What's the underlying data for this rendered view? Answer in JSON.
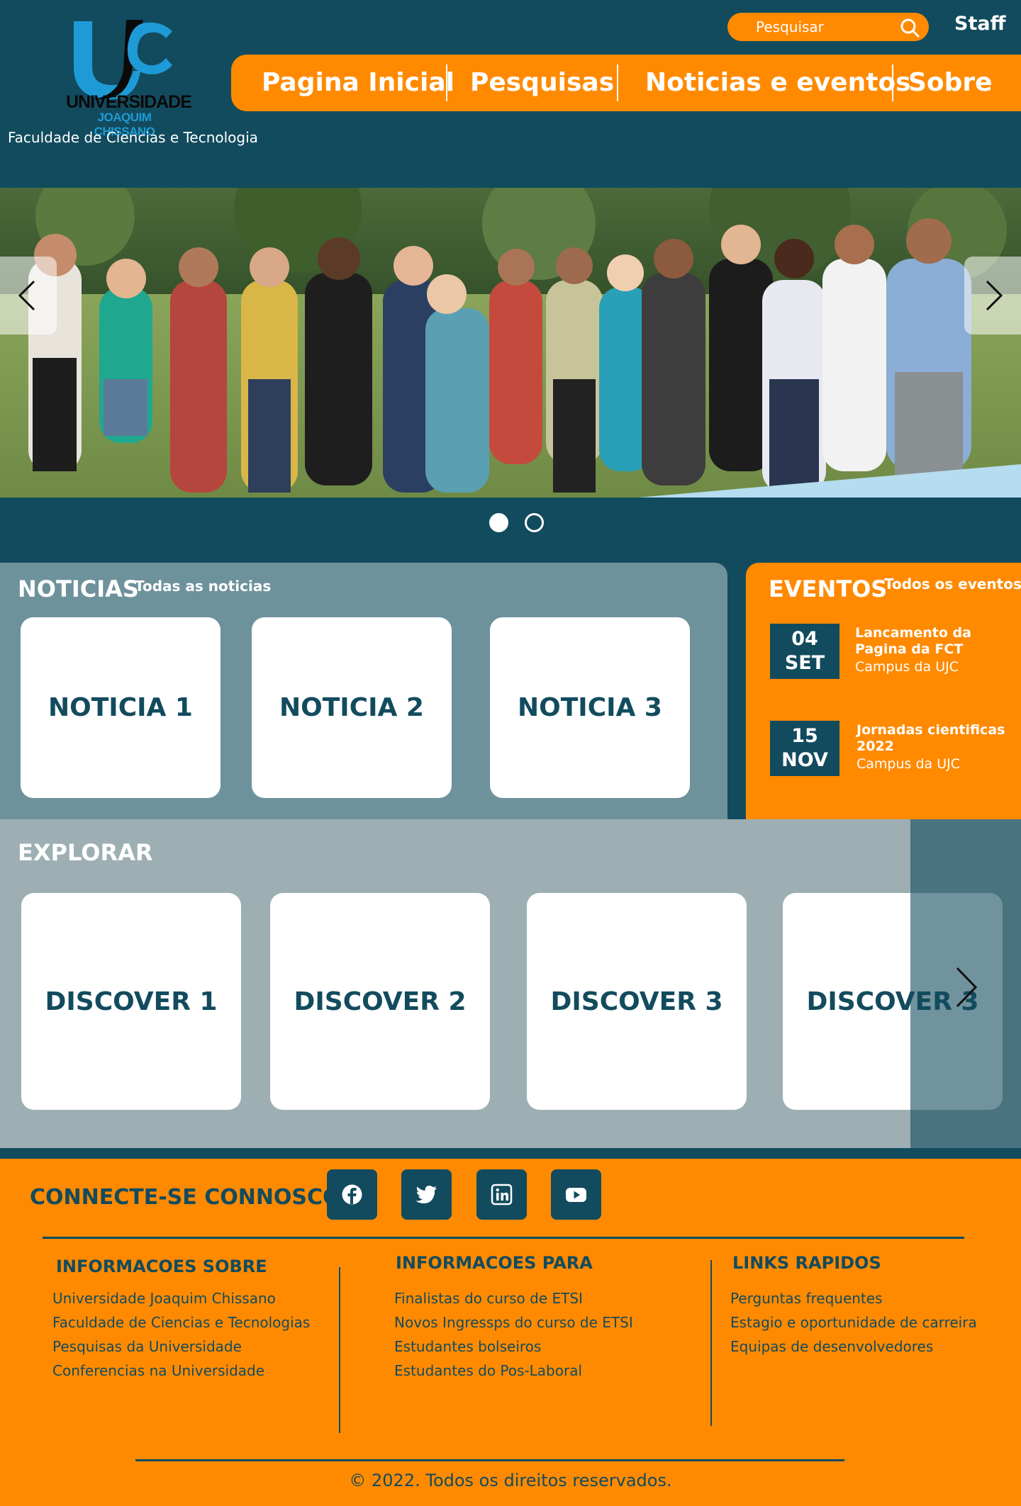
{
  "header": {
    "logo_line1": "UNIVERSIDADE",
    "logo_line2": "JOAQUIM CHISSANO",
    "faculty": "Faculdade de Ciencias e Tecnologia",
    "search_placeholder": "Pesquisar",
    "staff_label": "Staff",
    "nav": [
      "Pagina Inicial",
      "Pesquisas",
      "Noticias e eventos",
      "Sobre"
    ]
  },
  "hero": {
    "slide_count": 2,
    "active_slide": 1
  },
  "news": {
    "title": "NOTICIAS",
    "link": "Todas as noticias",
    "cards": [
      "NOTICIA 1",
      "NOTICIA 2",
      "NOTICIA 3"
    ]
  },
  "events": {
    "title": "EVENTOS",
    "link": "Todos os eventos",
    "items": [
      {
        "day": "04",
        "month": "SET",
        "title": "Lancamento da Pagina da FCT",
        "place": "Campus da UJC"
      },
      {
        "day": "15",
        "month": "NOV",
        "title": "Jornadas cientificas 2022",
        "place": "Campus da UJC"
      }
    ]
  },
  "explore": {
    "title": "EXPLORAR",
    "cards": [
      "DISCOVER 1",
      "DISCOVER 2",
      "DISCOVER 3",
      "DISCOVER 3"
    ]
  },
  "footer": {
    "connect": "CONNECTE-SE CONNOSCO",
    "social": [
      "facebook-icon",
      "twitter-icon",
      "linkedin-icon",
      "youtube-icon"
    ],
    "columns": [
      {
        "title": "INFORMACOES SOBRE",
        "links": [
          "Universidade Joaquim Chissano",
          "Faculdade de Ciencias e Tecnologias",
          "Pesquisas da Universidade",
          "Conferencias na Universidade"
        ]
      },
      {
        "title": "INFORMACOES PARA",
        "links": [
          "Finalistas do curso de ETSI",
          "Novos Ingressps do curso de ETSI",
          "Estudantes bolseiros",
          "Estudantes do Pos-Laboral"
        ]
      },
      {
        "title": "LINKS RAPIDOS",
        "links": [
          "Perguntas frequentes",
          "Estagio e oportunidade de carreira",
          "Equipas de desenvolvedores"
        ]
      }
    ],
    "copyright": "© 2022. Todos os direitos reservados."
  },
  "colors": {
    "primary": "#124b5e",
    "accent": "#ff8a00",
    "news_bg": "#6e929c",
    "explore_bg": "#9dafb3"
  }
}
